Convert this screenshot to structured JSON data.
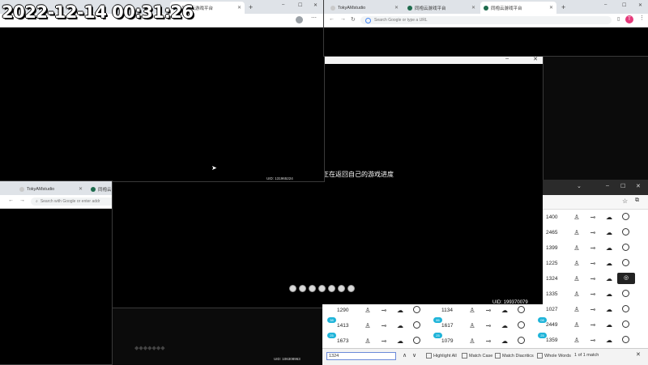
{
  "timestamp": "2022-12-14 00:31:26",
  "windows": {
    "top_left": {
      "tab_label": "同袍云游戏平台",
      "uid": "UID: 131965224"
    },
    "top_right": {
      "tabs": [
        "TokyAMstudio",
        "同袍云游戏平台",
        "同袍云游戏平台"
      ],
      "omnibox_placeholder": "Search Google or type a URL",
      "profile_initial": "T",
      "uid": "UID: 105423686"
    },
    "bottom_left": {
      "tabs": [
        "TokyAMstudio",
        "同袍云"
      ],
      "omnibox_placeholder": "Search with Google or enter addr",
      "uid": "UID: 106308963"
    },
    "game": {
      "subtitle": "正在返回自己的游戏进度",
      "uid": "UID: 199370079"
    }
  },
  "list_panel": {
    "right_column": [
      {
        "num": "1400"
      },
      {
        "num": "2465"
      },
      {
        "num": "1399"
      },
      {
        "num": "1225"
      },
      {
        "num": "1324",
        "selected": true
      },
      {
        "num": "1335"
      },
      {
        "num": "1027"
      },
      {
        "num": "2449"
      },
      {
        "num": "1359"
      }
    ],
    "bottom_rows": [
      {
        "a": "1290",
        "b": "1134"
      },
      {
        "a": "1413",
        "b": "1617"
      },
      {
        "a": "1673",
        "b": "1079"
      }
    ],
    "badges": [
      "38",
      "86",
      "08",
      "25",
      "25",
      "25"
    ]
  },
  "find_bar": {
    "query": "1324",
    "highlight_all": "Highlight All",
    "match_case": "Match Case",
    "match_diacritics": "Match Diacritics",
    "whole_words": "Whole Words",
    "result": "1 of 1 match"
  },
  "colors": {
    "badge": "#1fb4d9",
    "accent": "#1a73e8"
  }
}
